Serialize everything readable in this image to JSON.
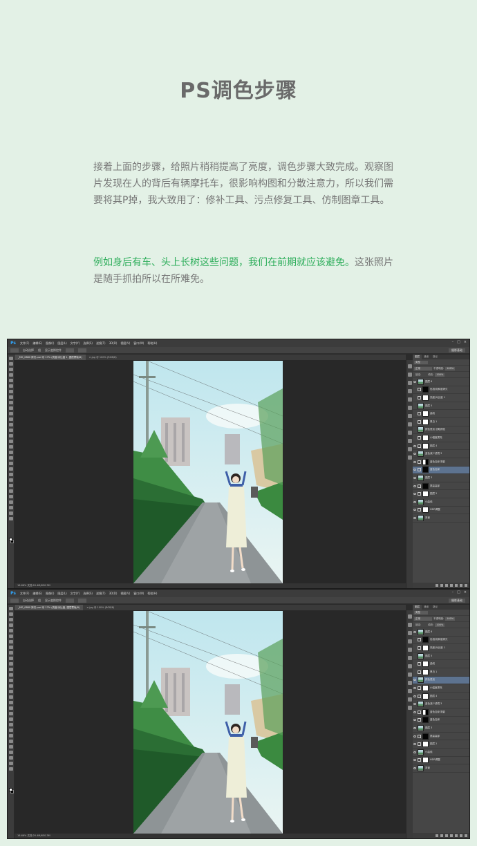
{
  "title": "PS调色步骤",
  "paragraph1": "接着上面的步骤，给照片稍稍提高了亮度，调色步骤大致完成。观察图片发现在人的背后有辆摩托车，很影响构图和分散注意力，所以我们需要将其P掉，我大致用了：修补工具、污点修复工具、仿制图章工具。",
  "paragraph2_highlight": "例如身后有车、头上长树这些问题，我们在前期就应该避免。",
  "paragraph2_rest": "这张照片是随手抓拍所以在所难免。",
  "screens": [
    {
      "menu": [
        "文件(F)",
        "编辑(E)",
        "图像(I)",
        "图层(L)",
        "文字(Y)",
        "选择(S)",
        "滤镜(T)",
        "3D(D)",
        "视图(V)",
        "窗口(W)",
        "帮助(H)"
      ],
      "options": [
        "自动选择",
        "组",
        "显示变换控件"
      ],
      "workspace": "摄影基础",
      "tabs": [
        "_MG_0880 拷贝.psd @ 17% (亮度/对比度 1, 图层蒙版/8)",
        "×.jpg @ 100% (RGB/8)"
      ],
      "status": "16.66%     文档:20.4M/650.3M",
      "panel_tabs": [
        "图层",
        "通道",
        "路径"
      ],
      "filter": "类型",
      "blend_mode": "正常",
      "opacity_label": "不透明度:",
      "opacity": "100%",
      "lock_label": "锁定:",
      "fill_label": "填充:",
      "fill": "100%",
      "layers": [
        {
          "name": "图层 6",
          "eye": true
        },
        {
          "name": "色相/饱和度拷贝",
          "eye": false
        },
        {
          "name": "亮度/对比度 1",
          "eye": false
        },
        {
          "name": "图层 5",
          "eye": false
        },
        {
          "name": "曲线",
          "eye": false
        },
        {
          "name": "黑白 1",
          "eye": false
        },
        {
          "name": "颜色叠加 选取颜色",
          "eye": false
        },
        {
          "name": "小幅度提亮",
          "eye": false
        },
        {
          "name": "图层 4",
          "eye": true
        },
        {
          "name": "蓝色减少滤镜 3",
          "eye": true
        },
        {
          "name": "蓝色加深 阴影",
          "eye": true
        },
        {
          "name": "蓝色加深",
          "eye": true,
          "selected": true
        },
        {
          "name": "图层 3",
          "eye": true
        },
        {
          "name": "提高高部",
          "eye": true
        },
        {
          "name": "图层 2",
          "eye": true
        },
        {
          "name": "小曲线",
          "eye": true
        },
        {
          "name": "HDR调整",
          "eye": true
        },
        {
          "name": "背景",
          "eye": true
        }
      ]
    },
    {
      "menu": [
        "文件(F)",
        "编辑(E)",
        "图像(I)",
        "图层(L)",
        "文字(Y)",
        "选择(S)",
        "滤镜(T)",
        "3D(D)",
        "视图(V)",
        "窗口(W)",
        "帮助(H)"
      ],
      "options": [
        "自动选择",
        "组",
        "显示变换控件"
      ],
      "workspace": "摄影基础",
      "tabs": [
        "_MG_0880 拷贝.psd @ 17% (亮度/对比度, 图层蒙版/8)",
        "×.jpg @ 100% (RGB/8)"
      ],
      "status": "16.66%     文档:20.4M/650.3M",
      "panel_tabs": [
        "图层",
        "通道",
        "路径"
      ],
      "filter": "类型",
      "blend_mode": "正常",
      "opacity_label": "不透明度:",
      "opacity": "100%",
      "lock_label": "锁定:",
      "fill_label": "填充:",
      "fill": "100%",
      "layers": [
        {
          "name": "图层 6",
          "eye": true
        },
        {
          "name": "色相/饱和度拷贝",
          "eye": false
        },
        {
          "name": "亮度/对比度 1",
          "eye": false
        },
        {
          "name": "图层 5",
          "eye": false
        },
        {
          "name": "曲线",
          "eye": false
        },
        {
          "name": "黑白 1",
          "eye": false
        },
        {
          "name": "颜色叠加",
          "eye": true,
          "selected": true
        },
        {
          "name": "小幅度提亮",
          "eye": true
        },
        {
          "name": "图层 4",
          "eye": true
        },
        {
          "name": "蓝色减少滤镜 3",
          "eye": true
        },
        {
          "name": "蓝色加深 阴影",
          "eye": true
        },
        {
          "name": "蓝色加深",
          "eye": true
        },
        {
          "name": "图层 3",
          "eye": true
        },
        {
          "name": "提高高部",
          "eye": true
        },
        {
          "name": "图层 2",
          "eye": true
        },
        {
          "name": "小曲线",
          "eye": true
        },
        {
          "name": "HDR调整",
          "eye": true
        },
        {
          "name": "背景",
          "eye": true
        }
      ]
    }
  ],
  "colors": {
    "page_bg": "#e3f1e6",
    "title": "#6a6a6a",
    "highlight": "#2fae5c",
    "selected_layer": "#5d7390"
  }
}
